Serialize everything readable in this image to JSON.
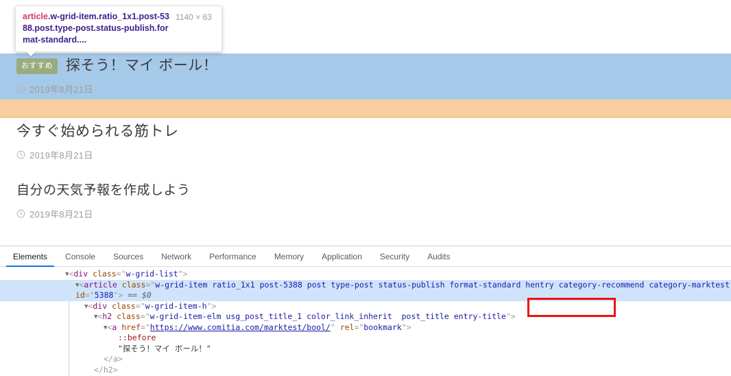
{
  "inspector_tooltip": {
    "selector_tag": "article",
    "selector_classes": ".w-grid-item.ratio_1x1.post-5388.post.type-post.status-publish.format-standard....",
    "dimensions": "1140 × 63",
    "colors": {
      "content_box": "#a5c9e9",
      "padding_box": "#f8cda0"
    }
  },
  "page": {
    "posts": [
      {
        "badge": "おすすめ",
        "title": "探そう！マイ ボール！",
        "date": "2019年8月21日",
        "date_icon": "clock-icon",
        "highlighted": true
      },
      {
        "badge": "",
        "title": "今すぐ始められる筋トレ",
        "date": "2019年8月21日",
        "date_icon": "clock-icon",
        "highlighted": false
      },
      {
        "badge": "",
        "title": "自分の天気予報を作成しよう",
        "date": "2019年8月21日",
        "date_icon": "clock-icon",
        "highlighted": false
      }
    ],
    "badge_color": "#9aab7e"
  },
  "devtools": {
    "tabs": [
      {
        "label": "Elements",
        "active": true
      },
      {
        "label": "Console",
        "active": false
      },
      {
        "label": "Sources",
        "active": false
      },
      {
        "label": "Network",
        "active": false
      },
      {
        "label": "Performance",
        "active": false
      },
      {
        "label": "Memory",
        "active": false
      },
      {
        "label": "Application",
        "active": false
      },
      {
        "label": "Security",
        "active": false
      },
      {
        "label": "Audits",
        "active": false
      }
    ],
    "active_tab_underline_color": "#1a73e8",
    "selection_highlight_color": "#cfe4fb",
    "annotation_box_color": "#ee1111",
    "annotated_text": "category-recommend",
    "dom": {
      "line1_tag": "div",
      "line1_attr": "class",
      "line1_val": "w-grid-list",
      "line2_tag": "article",
      "line2_attr": "class",
      "line2_val_a": "w-grid-item ratio_1x1 post-5388 post type-post status-publish format-standard hentry ",
      "line2_val_highlight": "category-recommend",
      "line2_val_b": " category-marktest",
      "line2_attr2": "data-id",
      "line2_val2": "5388",
      "line2_selected_marker": "== $0",
      "line3_tag": "div",
      "line3_attr": "class",
      "line3_val": "w-grid-item-h",
      "line4_tag": "h2",
      "line4_attr": "class",
      "line4_val": "w-grid-item-elm usg_post_title_1 color_link_inherit  post_title entry-title",
      "line5_tag": "a",
      "line5_attr": "href",
      "line5_val": "https://www.comitia.com/marktest/bool/",
      "line5_attr2": "rel",
      "line5_val2": "bookmark",
      "line6_pseudo": "::before",
      "line7_text": "\"探そう！マイ ボール！\"",
      "line8_close": "</a>",
      "line9_close": "</h2>"
    }
  }
}
